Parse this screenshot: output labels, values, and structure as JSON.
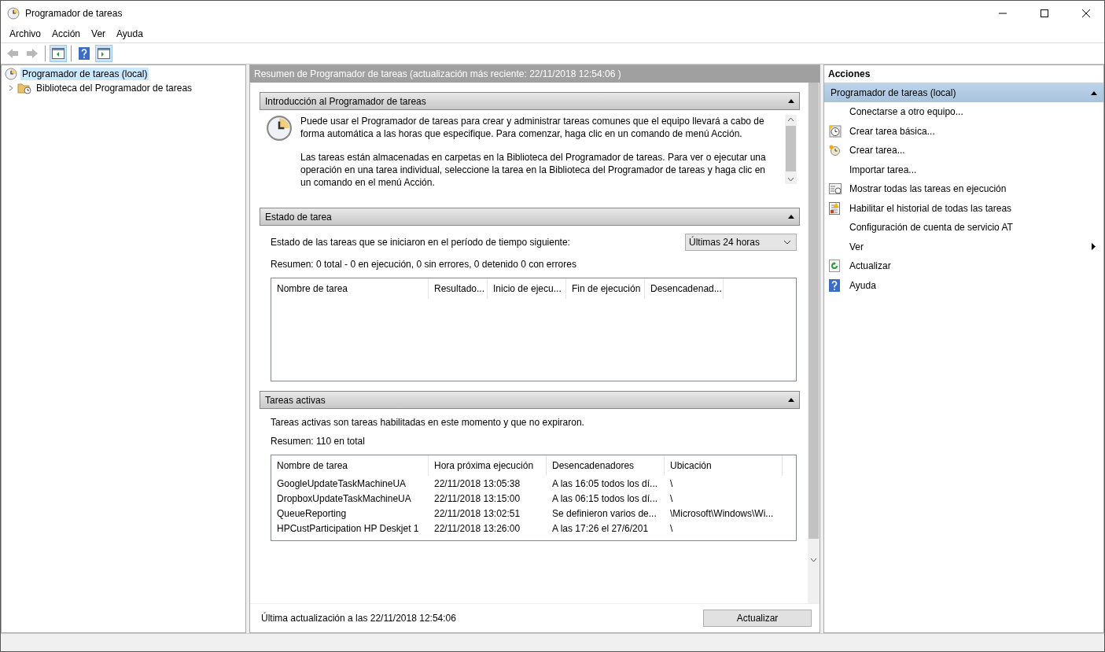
{
  "window": {
    "title": "Programador de tareas"
  },
  "menu": [
    "Archivo",
    "Acción",
    "Ver",
    "Ayuda"
  ],
  "toolbar": [
    {
      "kind": "back",
      "disabled": true,
      "pressed": false
    },
    {
      "kind": "forward",
      "disabled": true,
      "pressed": false
    },
    {
      "kind": "tree-pane",
      "disabled": false,
      "pressed": true
    },
    {
      "kind": "help",
      "disabled": false,
      "pressed": false
    },
    {
      "kind": "action-pane",
      "disabled": false,
      "pressed": true
    }
  ],
  "tree": [
    {
      "label": "Programador de tareas (local)",
      "selected": true,
      "children": [
        {
          "label": "Biblioteca del Programador de tareas",
          "selected": false,
          "expanded": false
        }
      ]
    }
  ],
  "summary": {
    "header": "Resumen de Programador de tareas (actualización más reciente: 22/11/2018 12:54:06 )",
    "intro": {
      "title": "Introducción al Programador de tareas",
      "expanded": true,
      "paragraphs": [
        "Puede usar el Programador de tareas para crear y administrar tareas comunes que el equipo llevará a cabo de forma automática a las horas que especifique. Para comenzar, haga clic en un comando de menú Acción.",
        "Las tareas están almacenadas en carpetas en la Biblioteca del Programador de tareas. Para ver o ejecutar una operación en una tarea individual, seleccione la tarea en la Biblioteca del Programador de tareas y haga clic en un comando en el menú Acción."
      ]
    },
    "status": {
      "title": "Estado de tarea",
      "expanded": true,
      "period_label": "Estado de las tareas que se iniciaron en el período de tiempo siguiente:",
      "period_value": "Últimas 24 horas",
      "summary": "Resumen: 0 total - 0 en ejecución, 0 sin errores, 0 detenido  0 con errores",
      "columns": [
        "Nombre de tarea",
        "Resultado...",
        "Inicio de ejecu...",
        "Fin de ejecución",
        "Desencadenad..."
      ]
    },
    "active": {
      "title": "Tareas activas",
      "expanded": true,
      "description": "Tareas activas son tareas habilitadas en este momento y que no expiraron.",
      "summary": "Resumen: 110 en total",
      "columns": [
        "Nombre de tarea",
        "Hora próxima ejecución",
        "Desencadenadores",
        "Ubicación"
      ],
      "rows": [
        [
          "GoogleUpdateTaskMachineUA",
          "22/11/2018 13:05:38",
          "A las 16:05  todos los dí...",
          "\\"
        ],
        [
          "DropboxUpdateTaskMachineUA",
          "22/11/2018 13:15:00",
          "A las 06:15  todos los dí...",
          "\\"
        ],
        [
          "QueueReporting",
          "22/11/2018 13:02:51",
          "Se definieron varios de...",
          "\\Microsoft\\Windows\\Wi..."
        ],
        [
          "HPCustParticipation HP Deskjet 1",
          "22/11/2018 13:26:00",
          "A las 17:26  el 27/6/201",
          "\\"
        ]
      ]
    },
    "last_update": "Última actualización a las 22/11/2018 12:54:06",
    "refresh_button": "Actualizar"
  },
  "actions": {
    "title": "Acciones",
    "group": {
      "title": "Programador de tareas (local)",
      "expanded": true,
      "items": [
        {
          "label": "Conectarse a otro equipo...",
          "kind": "plain"
        },
        {
          "label": "Crear tarea básica...",
          "kind": "basic-task"
        },
        {
          "label": "Crear tarea...",
          "kind": "task"
        },
        {
          "label": "Importar tarea...",
          "kind": "plain"
        },
        {
          "label": "Mostrar todas las tareas en ejecución",
          "kind": "running"
        },
        {
          "label": "Habilitar el historial de todas las tareas",
          "kind": "history"
        },
        {
          "label": "Configuración de cuenta de servicio AT",
          "kind": "plain"
        },
        {
          "label": "Ver",
          "kind": "submenu"
        },
        {
          "label": "Actualizar",
          "kind": "refresh"
        },
        {
          "label": "Ayuda",
          "kind": "help"
        }
      ]
    }
  }
}
